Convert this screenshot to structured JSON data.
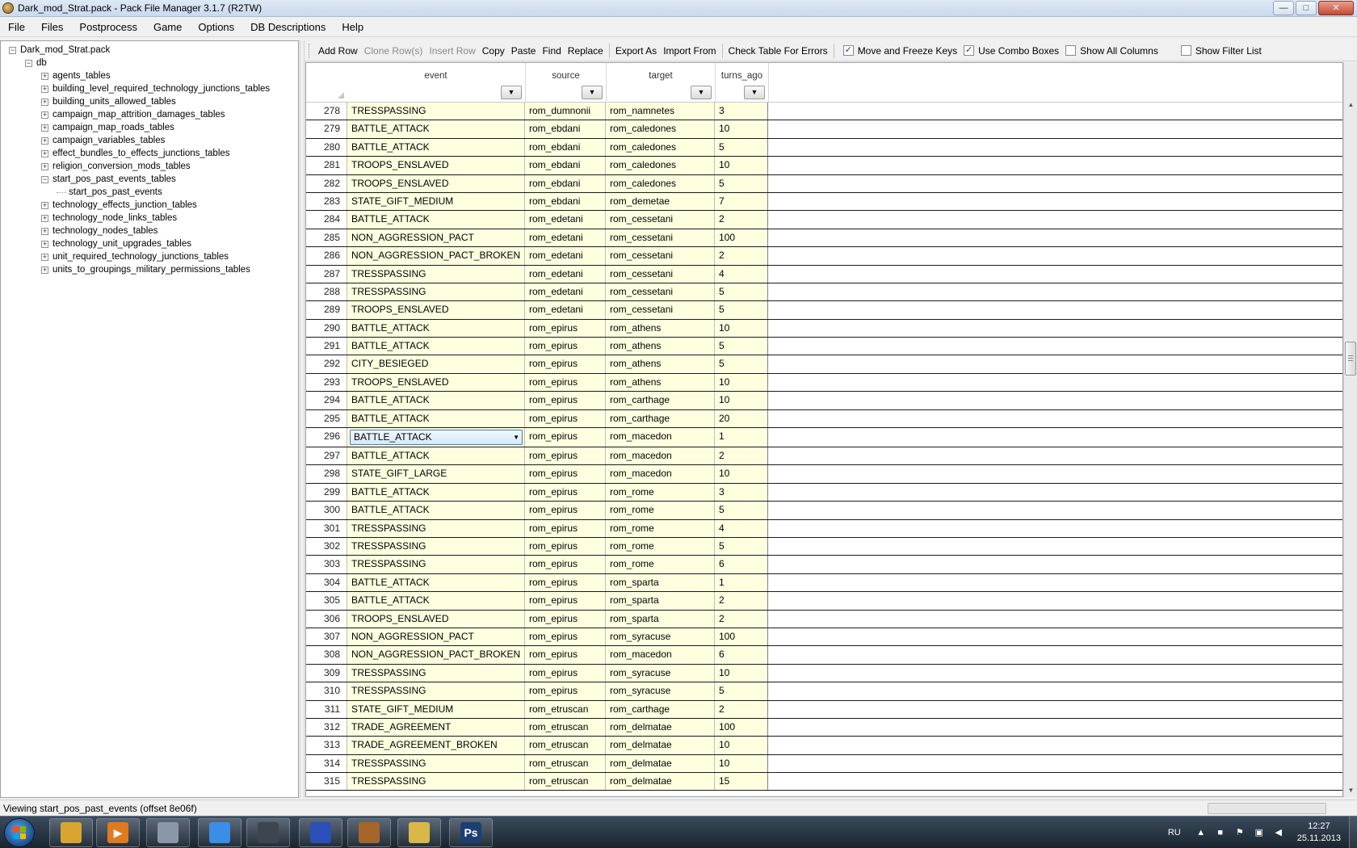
{
  "window": {
    "title": "Dark_mod_Strat.pack - Pack File Manager 3.1.7 (R2TW)",
    "minimize": "—",
    "maximize": "□",
    "close": "✕"
  },
  "menu": [
    "File",
    "Files",
    "Postprocess",
    "Game",
    "Options",
    "DB Descriptions",
    "Help"
  ],
  "tree": {
    "root": "Dark_mod_Strat.pack",
    "db": "db",
    "items": [
      {
        "label": "agents_tables",
        "expanded": false
      },
      {
        "label": "building_level_required_technology_junctions_tables",
        "expanded": false
      },
      {
        "label": "building_units_allowed_tables",
        "expanded": false
      },
      {
        "label": "campaign_map_attrition_damages_tables",
        "expanded": false
      },
      {
        "label": "campaign_map_roads_tables",
        "expanded": false
      },
      {
        "label": "campaign_variables_tables",
        "expanded": false
      },
      {
        "label": "effect_bundles_to_effects_junctions_tables",
        "expanded": false
      },
      {
        "label": "religion_conversion_mods_tables",
        "expanded": false
      },
      {
        "label": "start_pos_past_events_tables",
        "expanded": true
      },
      {
        "label": "start_pos_past_events",
        "child": true
      },
      {
        "label": "technology_effects_junction_tables",
        "expanded": false
      },
      {
        "label": "technology_node_links_tables",
        "expanded": false
      },
      {
        "label": "technology_nodes_tables",
        "expanded": false
      },
      {
        "label": "technology_unit_upgrades_tables",
        "expanded": false
      },
      {
        "label": "unit_required_technology_junctions_tables",
        "expanded": false
      },
      {
        "label": "units_to_groupings_military_permissions_tables",
        "expanded": false
      }
    ]
  },
  "toolbar": {
    "add_row": "Add Row",
    "clone_rows": "Clone Row(s)",
    "insert_row": "Insert Row",
    "copy": "Copy",
    "paste": "Paste",
    "find": "Find",
    "replace": "Replace",
    "export_as": "Export As",
    "import_from": "Import From",
    "check_table": "Check Table For Errors",
    "move_freeze": {
      "label": "Move and Freeze Keys",
      "checked": true
    },
    "combo_boxes": {
      "label": "Use Combo Boxes",
      "checked": true
    },
    "show_all_columns": {
      "label": "Show All Columns",
      "checked": false
    },
    "show_filter_list": {
      "label": "Show Filter List",
      "checked": false
    }
  },
  "grid": {
    "columns": [
      "event",
      "source",
      "target",
      "turns_ago"
    ],
    "selected_row": 296,
    "rows": [
      [
        278,
        "TRESSPASSING",
        "rom_dumnonii",
        "rom_namnetes",
        "3"
      ],
      [
        279,
        "BATTLE_ATTACK",
        "rom_ebdani",
        "rom_caledones",
        "10"
      ],
      [
        280,
        "BATTLE_ATTACK",
        "rom_ebdani",
        "rom_caledones",
        "5"
      ],
      [
        281,
        "TROOPS_ENSLAVED",
        "rom_ebdani",
        "rom_caledones",
        "10"
      ],
      [
        282,
        "TROOPS_ENSLAVED",
        "rom_ebdani",
        "rom_caledones",
        "5"
      ],
      [
        283,
        "STATE_GIFT_MEDIUM",
        "rom_ebdani",
        "rom_demetae",
        "7"
      ],
      [
        284,
        "BATTLE_ATTACK",
        "rom_edetani",
        "rom_cessetani",
        "2"
      ],
      [
        285,
        "NON_AGGRESSION_PACT",
        "rom_edetani",
        "rom_cessetani",
        "100"
      ],
      [
        286,
        "NON_AGGRESSION_PACT_BROKEN",
        "rom_edetani",
        "rom_cessetani",
        "2"
      ],
      [
        287,
        "TRESSPASSING",
        "rom_edetani",
        "rom_cessetani",
        "4"
      ],
      [
        288,
        "TRESSPASSING",
        "rom_edetani",
        "rom_cessetani",
        "5"
      ],
      [
        289,
        "TROOPS_ENSLAVED",
        "rom_edetani",
        "rom_cessetani",
        "5"
      ],
      [
        290,
        "BATTLE_ATTACK",
        "rom_epirus",
        "rom_athens",
        "10"
      ],
      [
        291,
        "BATTLE_ATTACK",
        "rom_epirus",
        "rom_athens",
        "5"
      ],
      [
        292,
        "CITY_BESIEGED",
        "rom_epirus",
        "rom_athens",
        "5"
      ],
      [
        293,
        "TROOPS_ENSLAVED",
        "rom_epirus",
        "rom_athens",
        "10"
      ],
      [
        294,
        "BATTLE_ATTACK",
        "rom_epirus",
        "rom_carthage",
        "10"
      ],
      [
        295,
        "BATTLE_ATTACK",
        "rom_epirus",
        "rom_carthage",
        "20"
      ],
      [
        296,
        "BATTLE_ATTACK",
        "rom_epirus",
        "rom_macedon",
        "1"
      ],
      [
        297,
        "BATTLE_ATTACK",
        "rom_epirus",
        "rom_macedon",
        "2"
      ],
      [
        298,
        "STATE_GIFT_LARGE",
        "rom_epirus",
        "rom_macedon",
        "10"
      ],
      [
        299,
        "BATTLE_ATTACK",
        "rom_epirus",
        "rom_rome",
        "3"
      ],
      [
        300,
        "BATTLE_ATTACK",
        "rom_epirus",
        "rom_rome",
        "5"
      ],
      [
        301,
        "TRESSPASSING",
        "rom_epirus",
        "rom_rome",
        "4"
      ],
      [
        302,
        "TRESSPASSING",
        "rom_epirus",
        "rom_rome",
        "5"
      ],
      [
        303,
        "TRESSPASSING",
        "rom_epirus",
        "rom_rome",
        "6"
      ],
      [
        304,
        "BATTLE_ATTACK",
        "rom_epirus",
        "rom_sparta",
        "1"
      ],
      [
        305,
        "BATTLE_ATTACK",
        "rom_epirus",
        "rom_sparta",
        "2"
      ],
      [
        306,
        "TROOPS_ENSLAVED",
        "rom_epirus",
        "rom_sparta",
        "2"
      ],
      [
        307,
        "NON_AGGRESSION_PACT",
        "rom_epirus",
        "rom_syracuse",
        "100"
      ],
      [
        308,
        "NON_AGGRESSION_PACT_BROKEN",
        "rom_epirus",
        "rom_macedon",
        "6"
      ],
      [
        309,
        "TRESSPASSING",
        "rom_epirus",
        "rom_syracuse",
        "10"
      ],
      [
        310,
        "TRESSPASSING",
        "rom_epirus",
        "rom_syracuse",
        "5"
      ],
      [
        311,
        "STATE_GIFT_MEDIUM",
        "rom_etruscan",
        "rom_carthage",
        "2"
      ],
      [
        312,
        "TRADE_AGREEMENT",
        "rom_etruscan",
        "rom_delmatae",
        "100"
      ],
      [
        313,
        "TRADE_AGREEMENT_BROKEN",
        "rom_etruscan",
        "rom_delmatae",
        "10"
      ],
      [
        314,
        "TRESSPASSING",
        "rom_etruscan",
        "rom_delmatae",
        "10"
      ],
      [
        315,
        "TRESSPASSING",
        "rom_etruscan",
        "rom_delmatae",
        "15"
      ]
    ]
  },
  "status": {
    "text": "Viewing start_pos_past_events (offset 8e06f)"
  },
  "taskbar": {
    "apps": [
      {
        "name": "explorer",
        "color": "#d9a531",
        "glyph": ""
      },
      {
        "name": "media-player",
        "color": "#e07a1f",
        "glyph": "▶"
      },
      {
        "name": "window-manager",
        "color": "#8a97a8",
        "glyph": ""
      },
      {
        "name": "chrome",
        "color": "#3a8ee6",
        "glyph": ""
      },
      {
        "name": "steam",
        "color": "#3c4550",
        "glyph": ""
      },
      {
        "name": "save-app",
        "color": "#2b4fb8",
        "glyph": ""
      },
      {
        "name": "pack-file-manager",
        "color": "#a6652a",
        "glyph": ""
      },
      {
        "name": "paint-app",
        "color": "#d9b84a",
        "glyph": ""
      },
      {
        "name": "photoshop",
        "color": "#1d3e73",
        "glyph": "Ps"
      }
    ],
    "language": "RU",
    "time": "12:27",
    "date": "25.11.2013"
  }
}
